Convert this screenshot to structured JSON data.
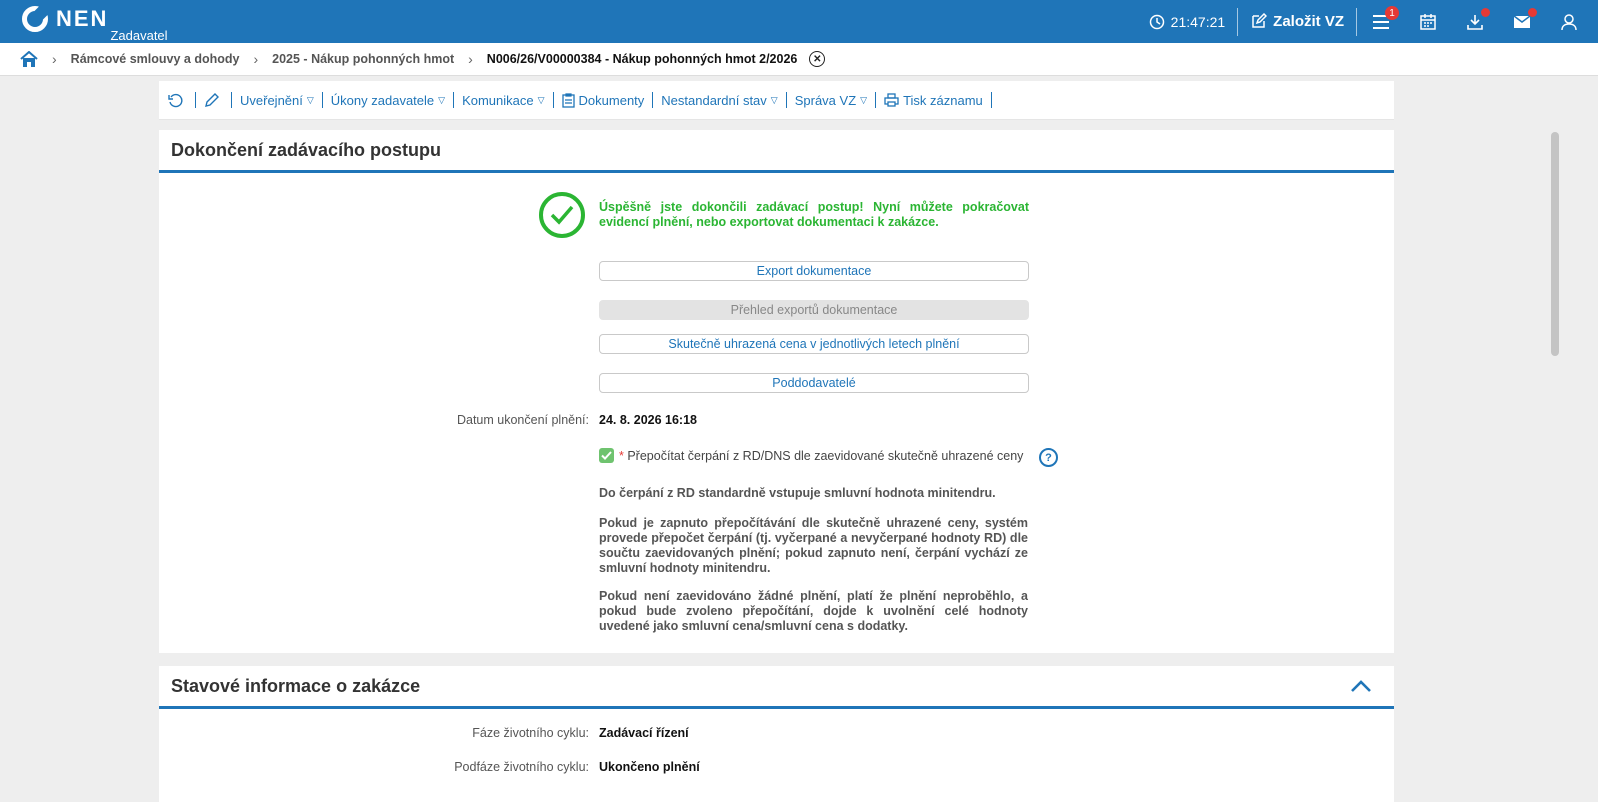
{
  "header": {
    "logo_text": "NEN",
    "logo_sub": "Zadavatel",
    "clock": "21:47:21",
    "create_label": "Založit VZ",
    "menu_badge": "1",
    "colors": {
      "brand": "#1f75b8",
      "success": "#2bb533",
      "alert": "#e53935"
    }
  },
  "breadcrumb": {
    "items": [
      "Rámcové smlouvy a dohody",
      "2025 - Nákup pohonných hmot"
    ],
    "current": "N006/26/V00000384 - Nákup pohonných hmot 2/2026"
  },
  "toolbar": {
    "items": [
      "Uveřejnění",
      "Úkony zadavatele",
      "Komunikace",
      "Dokumenty",
      "Nestandardní stav",
      "Správa VZ",
      "Tisk záznamu"
    ]
  },
  "completion": {
    "title": "Dokončení zadávacího postupu",
    "success_message": "Úspěšně jste dokončili zadávací postup! Nyní můžete pokračovat evidencí plnění, nebo exportovat dokumentaci k zakázce.",
    "buttons": {
      "export": "Export dokumentace",
      "overview": "Přehled exportů dokumentace",
      "price": "Skutečně uhrazená cena v jednotlivých letech plnění",
      "subcontractors": "Poddodavatelé"
    },
    "end_date_label": "Datum ukončení plnění:",
    "end_date_value": "24. 8. 2026 16:18",
    "recalc_label": "Přepočítat čerpání z RD/DNS dle zaevidované skutečně uhrazené ceny",
    "recalc_checked": true,
    "para1": "Do čerpání z RD standardně vstupuje smluvní hodnota minitendru.",
    "para2": "Pokud je zapnuto přepočítávání dle skutečně uhrazené ceny, systém provede přepočet čerpání (tj. vyčerpané a nevyčerpané hodnoty RD) dle součtu zaevidovaných plnění; pokud zapnuto není, čerpání vychází ze smluvní hodnoty minitendru.",
    "para3": "Pokud není zaevidováno žádné plnění, platí že plnění neproběhlo, a pokud bude zvoleno přepočítání, dojde k uvolnění celé hodnoty uvedené jako smluvní cena/smluvní cena s dodatky."
  },
  "status": {
    "title": "Stavové informace o zakázce",
    "phase_label": "Fáze životního cyklu:",
    "phase_value": "Zadávací řízení",
    "subphase_label": "Podfáze životního cyklu:",
    "subphase_value": "Ukončeno plnění"
  }
}
